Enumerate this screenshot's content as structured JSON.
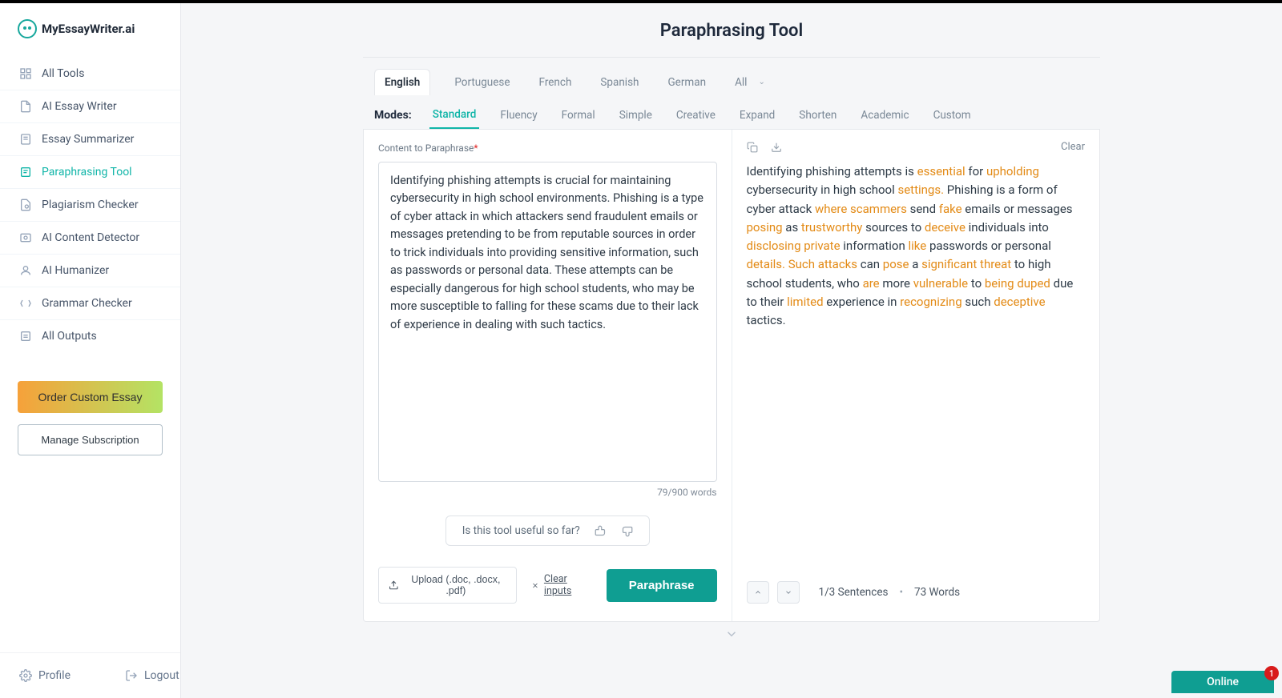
{
  "brand": "MyEssayWriter.ai",
  "sidebar": {
    "items": [
      {
        "label": "All Tools"
      },
      {
        "label": "AI Essay Writer"
      },
      {
        "label": "Essay Summarizer"
      },
      {
        "label": "Paraphrasing Tool"
      },
      {
        "label": "Plagiarism Checker"
      },
      {
        "label": "AI Content Detector"
      },
      {
        "label": "AI Humanizer"
      },
      {
        "label": "Grammar Checker"
      },
      {
        "label": "All Outputs"
      }
    ],
    "order_essay": "Order Custom Essay",
    "manage_sub": "Manage Subscription",
    "profile": "Profile",
    "logout": "Logout"
  },
  "header": {
    "title": "Paraphrasing Tool"
  },
  "languages": [
    "English",
    "Portuguese",
    "French",
    "Spanish",
    "German",
    "All"
  ],
  "active_language": "English",
  "modes_label": "Modes:",
  "modes": [
    "Standard",
    "Fluency",
    "Formal",
    "Simple",
    "Creative",
    "Expand",
    "Shorten",
    "Academic",
    "Custom"
  ],
  "active_mode": "Standard",
  "input": {
    "label": "Content to Paraphrase",
    "text": "Identifying phishing attempts is crucial for maintaining cybersecurity in high school environments. Phishing is a type of cyber attack in which attackers send fraudulent emails or messages pretending to be from reputable sources in order to trick individuals into providing sensitive information, such as passwords or personal data. These attempts can be especially dangerous for high school students, who may be more susceptible to falling for these scams due to their lack of experience in dealing with such tactics.",
    "word_count": "79/900 words",
    "useful_prompt": "Is this tool useful so far?",
    "upload_label": "Upload (.doc, .docx, .pdf)",
    "clear_inputs": "Clear inputs",
    "paraphrase": "Paraphrase"
  },
  "output": {
    "clear": "Clear",
    "segments": [
      {
        "t": "Identifying phishing attempts is ",
        "h": false
      },
      {
        "t": "essential",
        "h": true
      },
      {
        "t": " for ",
        "h": false
      },
      {
        "t": "upholding",
        "h": true
      },
      {
        "t": " cybersecurity in high school ",
        "h": false
      },
      {
        "t": "settings.",
        "h": true
      },
      {
        "t": " Phishing is a form of cyber attack ",
        "h": false
      },
      {
        "t": "where scammers",
        "h": true
      },
      {
        "t": " send ",
        "h": false
      },
      {
        "t": "fake",
        "h": true
      },
      {
        "t": " emails or messages ",
        "h": false
      },
      {
        "t": "posing",
        "h": true
      },
      {
        "t": " as ",
        "h": false
      },
      {
        "t": "trustworthy",
        "h": true
      },
      {
        "t": " sources to ",
        "h": false
      },
      {
        "t": "deceive",
        "h": true
      },
      {
        "t": " individuals into ",
        "h": false
      },
      {
        "t": "disclosing private",
        "h": true
      },
      {
        "t": " information ",
        "h": false
      },
      {
        "t": "like",
        "h": true
      },
      {
        "t": " passwords or personal ",
        "h": false
      },
      {
        "t": "details. Such attacks",
        "h": true
      },
      {
        "t": " can ",
        "h": false
      },
      {
        "t": "pose",
        "h": true
      },
      {
        "t": " a ",
        "h": false
      },
      {
        "t": "significant threat",
        "h": true
      },
      {
        "t": " to high school students, who ",
        "h": false
      },
      {
        "t": "are",
        "h": true
      },
      {
        "t": " more ",
        "h": false
      },
      {
        "t": "vulnerable",
        "h": true
      },
      {
        "t": " to ",
        "h": false
      },
      {
        "t": "being duped",
        "h": true
      },
      {
        "t": " due to their ",
        "h": false
      },
      {
        "t": "limited",
        "h": true
      },
      {
        "t": " experience in ",
        "h": false
      },
      {
        "t": "recognizing",
        "h": true
      },
      {
        "t": " such ",
        "h": false
      },
      {
        "t": "deceptive",
        "h": true
      },
      {
        "t": " tactics.",
        "h": false
      }
    ],
    "sentence_pos": "1/3 Sentences",
    "word_total": "73 Words"
  },
  "status": {
    "online": "Online",
    "notif_count": "1"
  }
}
